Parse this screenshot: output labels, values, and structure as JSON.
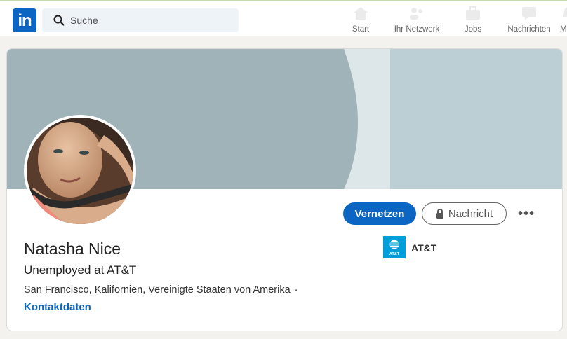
{
  "nav": {
    "logo_text": "in",
    "search_placeholder": "Suche",
    "items": [
      {
        "label": "Start",
        "icon": "home-icon"
      },
      {
        "label": "Ihr Netzwerk",
        "icon": "network-icon"
      },
      {
        "label": "Jobs",
        "icon": "briefcase-icon"
      },
      {
        "label": "Nachrichten",
        "icon": "messaging-icon"
      },
      {
        "label": "M",
        "icon": "notifications-icon"
      }
    ]
  },
  "profile": {
    "name": "Natasha Nice",
    "headline": "Unemployed at AT&T",
    "location": "San Francisco, Kalifornien, Vereinigte Staaten von Amerika",
    "location_separator": "·",
    "contact_link": "Kontaktdaten",
    "company_name": "AT&T",
    "company_logo_text": "AT&T"
  },
  "actions": {
    "connect_label": "Vernetzen",
    "message_label": "Nachricht",
    "more_label": "•••"
  },
  "colors": {
    "brand": "#0a66c2",
    "banner_gray": "#9fb3b8",
    "banner_light": "#dde6e9",
    "banner_right": "#bccfd4",
    "company_logo_bg": "#009fdb"
  }
}
